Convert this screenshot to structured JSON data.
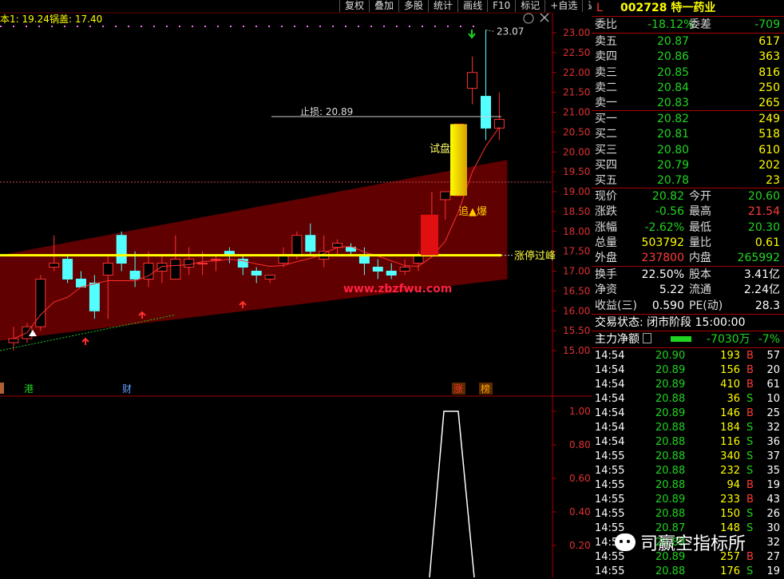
{
  "header": {
    "cost_label": "本1: 19.24",
    "pot_label": "锅盖: 17.40"
  },
  "toolbar": [
    "复权",
    "叠加",
    "多股",
    "统计",
    "画线",
    "F10",
    "标记",
    "+自选",
    "返回"
  ],
  "main_chart": {
    "price_ticks": [
      "23.00",
      "22.50",
      "22.00",
      "21.50",
      "21.00",
      "20.50",
      "20.00",
      "19.50",
      "19.00",
      "18.50",
      "18.00",
      "17.50",
      "17.00",
      "16.50",
      "16.00",
      "15.50",
      "15.00"
    ],
    "high_label": "23.07",
    "stop_label": "止损: 20.89",
    "limit_label": "涨停过峰",
    "try_label": "试盘",
    "burst_label": "追▲爆",
    "site_label": "www.zbzfwu.com",
    "markers": [
      "港",
      "财",
      "涨",
      "榜"
    ],
    "colors": {
      "up": "#ff3232",
      "down": "#54ffff",
      "band": "#6a0000",
      "limit_line": "#ffff00"
    }
  },
  "chart_data": {
    "type": "candlestick",
    "ylim": [
      14.8,
      23.2
    ],
    "candles": [
      {
        "o": 15.2,
        "h": 15.6,
        "l": 15.0,
        "c": 15.3
      },
      {
        "o": 15.3,
        "h": 15.7,
        "l": 15.2,
        "c": 15.6
      },
      {
        "o": 15.6,
        "h": 16.9,
        "l": 15.5,
        "c": 16.8
      },
      {
        "o": 17.1,
        "h": 17.9,
        "l": 17.0,
        "c": 17.2
      },
      {
        "o": 17.3,
        "h": 17.4,
        "l": 16.7,
        "c": 16.8
      },
      {
        "o": 16.8,
        "h": 17.0,
        "l": 16.6,
        "c": 16.6
      },
      {
        "o": 16.7,
        "h": 16.9,
        "l": 15.8,
        "c": 16.0
      },
      {
        "o": 16.9,
        "h": 17.4,
        "l": 15.8,
        "c": 17.2
      },
      {
        "o": 17.9,
        "h": 18.0,
        "l": 17.0,
        "c": 17.2
      },
      {
        "o": 17.0,
        "h": 17.5,
        "l": 16.6,
        "c": 16.8
      },
      {
        "o": 16.8,
        "h": 17.5,
        "l": 16.6,
        "c": 17.2
      },
      {
        "o": 17.0,
        "h": 17.4,
        "l": 16.7,
        "c": 17.2
      },
      {
        "o": 16.8,
        "h": 17.9,
        "l": 16.8,
        "c": 17.3
      },
      {
        "o": 17.1,
        "h": 17.6,
        "l": 16.9,
        "c": 17.3
      },
      {
        "o": 17.2,
        "h": 17.5,
        "l": 16.9,
        "c": 17.2
      },
      {
        "o": 17.3,
        "h": 17.4,
        "l": 17.0,
        "c": 17.3
      },
      {
        "o": 17.5,
        "h": 17.6,
        "l": 17.2,
        "c": 17.4
      },
      {
        "o": 17.3,
        "h": 17.4,
        "l": 16.9,
        "c": 17.1
      },
      {
        "o": 17.0,
        "h": 17.1,
        "l": 16.7,
        "c": 16.9
      },
      {
        "o": 16.8,
        "h": 16.9,
        "l": 16.7,
        "c": 16.9
      },
      {
        "o": 17.2,
        "h": 17.6,
        "l": 17.1,
        "c": 17.4
      },
      {
        "o": 17.4,
        "h": 18.0,
        "l": 17.3,
        "c": 17.9
      },
      {
        "o": 17.9,
        "h": 18.2,
        "l": 17.4,
        "c": 17.5
      },
      {
        "o": 17.3,
        "h": 17.9,
        "l": 17.1,
        "c": 17.5
      },
      {
        "o": 17.6,
        "h": 17.8,
        "l": 17.4,
        "c": 17.7
      },
      {
        "o": 17.6,
        "h": 17.7,
        "l": 17.4,
        "c": 17.5
      },
      {
        "o": 17.4,
        "h": 17.6,
        "l": 16.9,
        "c": 17.2
      },
      {
        "o": 17.1,
        "h": 17.3,
        "l": 16.8,
        "c": 17.0
      },
      {
        "o": 17.0,
        "h": 17.2,
        "l": 16.8,
        "c": 16.9
      },
      {
        "o": 17.0,
        "h": 17.3,
        "l": 16.9,
        "c": 17.1
      },
      {
        "o": 17.2,
        "h": 17.5,
        "l": 17.0,
        "c": 17.4
      },
      {
        "o": 17.4,
        "h": 19.0,
        "l": 17.4,
        "c": 18.4
      },
      {
        "o": 18.8,
        "h": 19.0,
        "l": 18.3,
        "c": 19.0
      },
      {
        "o": 18.9,
        "h": 20.7,
        "l": 18.9,
        "c": 20.7
      },
      {
        "o": 21.6,
        "h": 22.4,
        "l": 21.2,
        "c": 22.0
      },
      {
        "o": 21.4,
        "h": 23.07,
        "l": 20.3,
        "c": 20.6
      },
      {
        "o": 20.6,
        "h": 21.5,
        "l": 20.3,
        "c": 20.82
      }
    ],
    "subchart": {
      "ticks": [
        "1.00",
        "0.80",
        "0.60",
        "0.40",
        "0.20"
      ],
      "ylim": [
        0,
        1
      ]
    }
  },
  "quote": {
    "code": "002728",
    "name": "特一药业",
    "market_flag": "L",
    "weibi_label": "委比",
    "weibi_value": "-18.12%",
    "weicha_label": "委差",
    "weicha_value": "-709",
    "asks": [
      {
        "label": "卖五",
        "price": "20.87",
        "vol": "617"
      },
      {
        "label": "卖四",
        "price": "20.86",
        "vol": "363"
      },
      {
        "label": "卖三",
        "price": "20.85",
        "vol": "816"
      },
      {
        "label": "卖二",
        "price": "20.84",
        "vol": "250"
      },
      {
        "label": "卖一",
        "price": "20.83",
        "vol": "265"
      }
    ],
    "bids": [
      {
        "label": "买一",
        "price": "20.82",
        "vol": "249"
      },
      {
        "label": "买二",
        "price": "20.81",
        "vol": "518"
      },
      {
        "label": "买三",
        "price": "20.80",
        "vol": "610"
      },
      {
        "label": "买四",
        "price": "20.79",
        "vol": "202"
      },
      {
        "label": "买五",
        "price": "20.78",
        "vol": "23"
      }
    ],
    "stats": [
      {
        "l1": "现价",
        "v1": "20.82",
        "c1": "grn",
        "l2": "今开",
        "v2": "20.60",
        "c2": "grn"
      },
      {
        "l1": "涨跌",
        "v1": "-0.56",
        "c1": "grn",
        "l2": "最高",
        "v2": "21.54",
        "c2": "red"
      },
      {
        "l1": "涨幅",
        "v1": "-2.62%",
        "c1": "grn",
        "l2": "最低",
        "v2": "20.30",
        "c2": "grn"
      },
      {
        "l1": "总量",
        "v1": "503792",
        "c1": "yel",
        "l2": "量比",
        "v2": "0.61",
        "c2": "yel"
      },
      {
        "l1": "外盘",
        "v1": "237800",
        "c1": "red",
        "l2": "内盘",
        "v2": "265992",
        "c2": "grn"
      }
    ],
    "stats2": [
      {
        "l1": "换手",
        "v1": "22.50%",
        "l2": "股本",
        "v2": "3.41亿"
      },
      {
        "l1": "净资",
        "v1": "5.22",
        "l2": "流通",
        "v2": "2.24亿"
      },
      {
        "l1": "收益(三)",
        "v1": "0.590",
        "l2": "PE(动)",
        "v2": "28.3"
      }
    ],
    "trade_status_label": "交易状态: 闭市阶段 15:00:00",
    "main_net_label": "主力净额",
    "main_net_value": "-7030万",
    "main_net_pct": "-7%",
    "ticks": [
      {
        "t": "14:54",
        "p": "20.90",
        "v": "193",
        "s": "B",
        "n": "57"
      },
      {
        "t": "14:54",
        "p": "20.89",
        "v": "156",
        "s": "B",
        "n": "20"
      },
      {
        "t": "14:54",
        "p": "20.89",
        "v": "410",
        "s": "B",
        "n": "61"
      },
      {
        "t": "14:54",
        "p": "20.88",
        "v": "36",
        "s": "S",
        "n": "10"
      },
      {
        "t": "14:54",
        "p": "20.89",
        "v": "146",
        "s": "B",
        "n": "25"
      },
      {
        "t": "14:54",
        "p": "20.88",
        "v": "184",
        "s": "S",
        "n": "32"
      },
      {
        "t": "14:54",
        "p": "20.88",
        "v": "116",
        "s": "S",
        "n": "36"
      },
      {
        "t": "14:55",
        "p": "20.88",
        "v": "340",
        "s": "S",
        "n": "37"
      },
      {
        "t": "14:55",
        "p": "20.88",
        "v": "232",
        "s": "S",
        "n": "35"
      },
      {
        "t": "14:55",
        "p": "20.88",
        "v": "94",
        "s": "B",
        "n": "19"
      },
      {
        "t": "14:55",
        "p": "20.89",
        "v": "233",
        "s": "B",
        "n": "43"
      },
      {
        "t": "14:55",
        "p": "20.88",
        "v": "150",
        "s": "S",
        "n": "26"
      },
      {
        "t": "14:55",
        "p": "20.87",
        "v": "148",
        "s": "S",
        "n": "30"
      },
      {
        "t": "14:55",
        "p": "20.89",
        "v": "",
        "s": "",
        "n": "32"
      },
      {
        "t": "14:55",
        "p": "20.89",
        "v": "257",
        "s": "B",
        "n": "27"
      },
      {
        "t": "14:55",
        "p": "20.88",
        "v": "176",
        "s": "S",
        "n": "19"
      }
    ]
  },
  "watermark": "司赢空指标所"
}
